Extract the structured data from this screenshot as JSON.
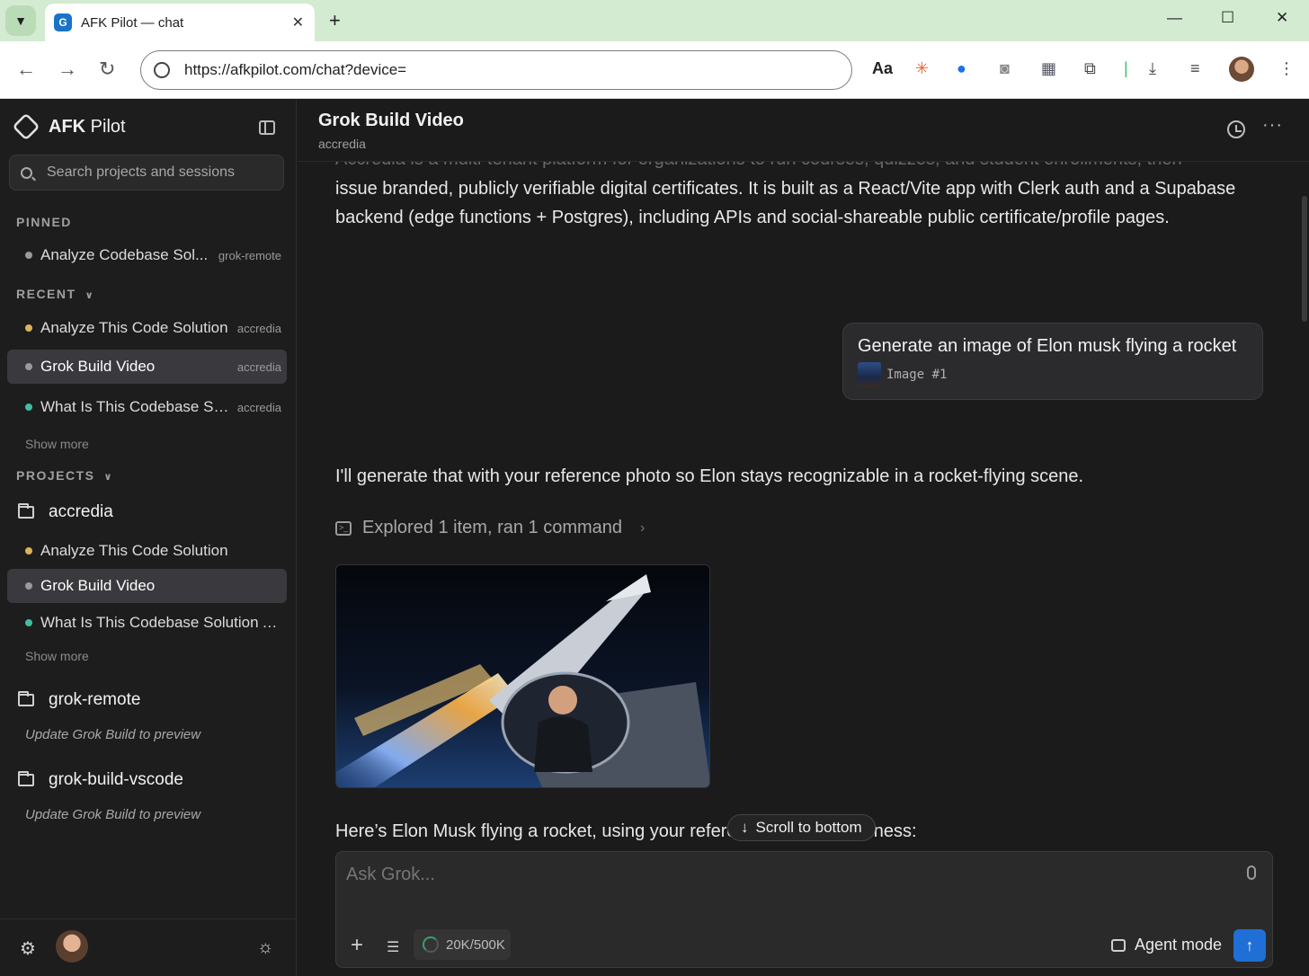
{
  "browser": {
    "tab_title": "AFK Pilot — chat",
    "url": "https://afkpilot.com/chat?device=",
    "new_tab": "+",
    "close_tab": "✕",
    "minimize": "—",
    "maximize": "☐",
    "close_window": "✕",
    "ext_reader": "Aa"
  },
  "sidebar": {
    "brand_first": "AFK",
    "brand_second": " Pilot",
    "search_placeholder": "Search projects and sessions",
    "pinned_heading": "PINNED",
    "pinned": [
      {
        "label": "Analyze Codebase Sol...",
        "tag": "grok-remote",
        "color": "#9a9a9a"
      }
    ],
    "recent_heading": "RECENT",
    "recent": [
      {
        "label": "Analyze This Code Solution",
        "tag": "accredia",
        "color": "#d9b45a"
      },
      {
        "label": "Grok Build Video",
        "tag": "accredia",
        "color": "#9a9a9a"
      },
      {
        "label": "What Is This Codebase Sol...",
        "tag": "accredia",
        "color": "#3fbf9f"
      }
    ],
    "show_more": "Show more",
    "projects_heading": "PROJECTS",
    "projects": [
      {
        "name": "accredia",
        "sessions": [
          {
            "label": "Analyze This Code Solution",
            "color": "#d9b45a"
          },
          {
            "label": "Grok Build Video",
            "color": "#9a9a9a"
          },
          {
            "label": "What Is This Codebase Solution A...",
            "color": "#3fbf9f"
          }
        ],
        "show_more": "Show more"
      },
      {
        "name": "grok-remote",
        "subtitle": "Update Grok Build to preview"
      },
      {
        "name": "grok-build-vscode",
        "subtitle": "Update Grok Build to preview"
      }
    ]
  },
  "chat": {
    "title": "Grok Build Video",
    "subtitle": "accredia",
    "faded_line": "Accredia is a multi-tenant platform for organizations to run courses, quizzes, and student enrollments, then",
    "paragraph": "issue branded, publicly verifiable digital certificates. It is built as a React/Vite app with Clerk auth and a Supabase backend (edge functions + Postgres), including APIs and social-shareable public certificate/profile pages.",
    "user_message": "Generate an image of Elon musk flying a rocket",
    "attachment_label": "Image #1",
    "assistant_reply": "I'll generate that with your reference photo so Elon stays recognizable in a rocket-flying scene.",
    "explored": "Explored 1 item, ran 1 command",
    "bottom_text": "Here’s Elon Musk flying a rocket, using your reference photo for likeness:",
    "scroll_to_bottom": "Scroll to bottom"
  },
  "composer": {
    "placeholder": "Ask Grok...",
    "context_usage": "20K/500K",
    "agent_mode": "Agent mode"
  },
  "colors": {
    "accent": "#1f6fd6",
    "active_item": "#3a3a3e",
    "background": "#1b1b1b"
  }
}
